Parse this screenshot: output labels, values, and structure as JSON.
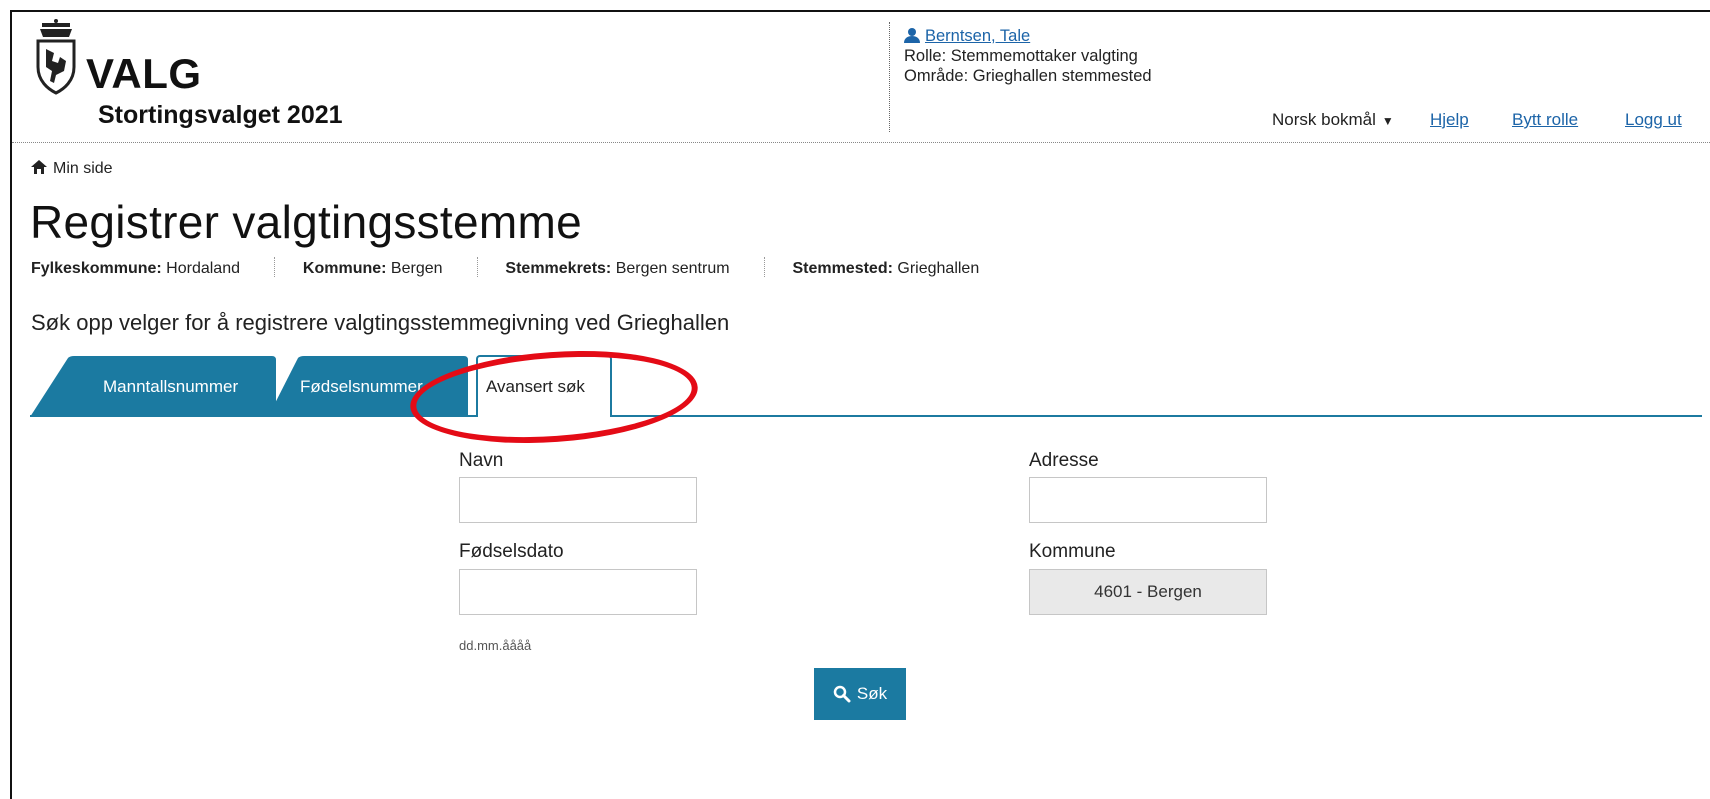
{
  "app": {
    "logo_text": "VALG",
    "election": "Stortingsvalget 2021"
  },
  "user": {
    "name": "Berntsen, Tale",
    "role": "Rolle: Stemmemottaker valgting",
    "area": "Område: Grieghallen stemmested"
  },
  "topnav": {
    "language": "Norsk bokmål",
    "help": "Hjelp",
    "switch_role": "Bytt rolle",
    "logout": "Logg ut"
  },
  "breadcrumb": {
    "home": "Min side"
  },
  "page": {
    "title": "Registrer valgtingsstemme",
    "meta": [
      {
        "label": "Fylkeskommune:",
        "value": "Hordaland"
      },
      {
        "label": "Kommune:",
        "value": "Bergen"
      },
      {
        "label": "Stemmekrets:",
        "value": "Bergen sentrum"
      },
      {
        "label": "Stemmested:",
        "value": "Grieghallen"
      }
    ],
    "instruction": "Søk opp velger for å registrere valgtingsstemmegivning ved Grieghallen"
  },
  "tabs": [
    {
      "label": "Manntallsnummer",
      "active": false
    },
    {
      "label": "Fødselsnummer",
      "active": false
    },
    {
      "label": "Avansert søk",
      "active": true
    }
  ],
  "form": {
    "name_label": "Navn",
    "name_value": "",
    "address_label": "Adresse",
    "address_value": "",
    "birthdate_label": "Fødselsdato",
    "birthdate_value": "",
    "birthdate_hint": "dd.mm.åååå",
    "municipality_label": "Kommune",
    "municipality_value": "4601 - Bergen",
    "search_button": "Søk"
  },
  "colors": {
    "accent": "#1b7aa1",
    "link": "#1c64a8",
    "highlight": "#e40b16"
  }
}
